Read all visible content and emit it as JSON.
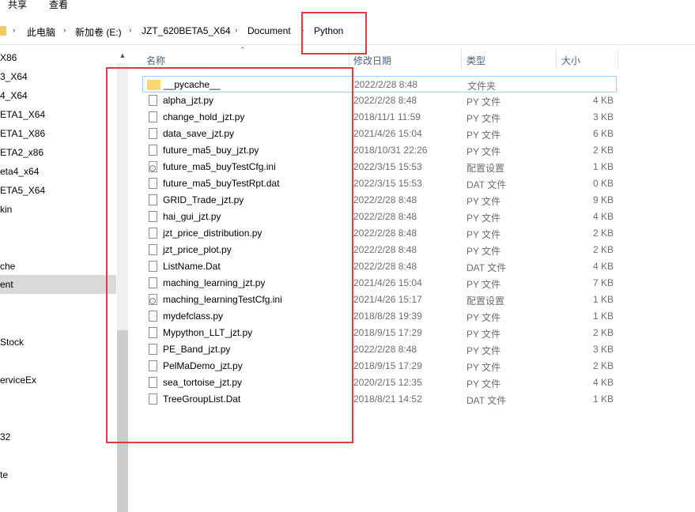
{
  "ribbon": {
    "share": "共享",
    "view": "查看"
  },
  "breadcrumb": [
    "此电脑",
    "新加卷 (E:)",
    "JZT_620BETA5_X64",
    "Document",
    "Python"
  ],
  "nav_items": [
    {
      "label": "X86",
      "selected": false
    },
    {
      "label": "3_X64",
      "selected": false
    },
    {
      "label": "4_X64",
      "selected": false
    },
    {
      "label": "ETA1_X64",
      "selected": false
    },
    {
      "label": "ETA1_X86",
      "selected": false
    },
    {
      "label": "ETA2_x86",
      "selected": false
    },
    {
      "label": "eta4_x64",
      "selected": false
    },
    {
      "label": "ETA5_X64",
      "selected": false
    },
    {
      "label": "kin",
      "selected": false
    },
    {
      "label": "che",
      "selected": false
    },
    {
      "label": "ent",
      "selected": true
    },
    {
      "label": "Stock",
      "selected": false
    },
    {
      "label": "erviceEx",
      "selected": false
    },
    {
      "label": "32",
      "selected": false
    },
    {
      "label": "te",
      "selected": false
    }
  ],
  "columns": {
    "name": "名称",
    "date": "修改日期",
    "type": "类型",
    "size": "大小"
  },
  "files": [
    {
      "name": "__pycache__",
      "date": "2022/2/28 8:48",
      "type": "文件夹",
      "size": "",
      "icon": "folder-icon",
      "selected": true
    },
    {
      "name": "alpha_jzt.py",
      "date": "2022/2/28 8:48",
      "type": "PY 文件",
      "size": "4 KB",
      "icon": "file-icon"
    },
    {
      "name": "change_hold_jzt.py",
      "date": "2018/11/1 11:59",
      "type": "PY 文件",
      "size": "3 KB",
      "icon": "file-icon"
    },
    {
      "name": "data_save_jzt.py",
      "date": "2021/4/26 15:04",
      "type": "PY 文件",
      "size": "6 KB",
      "icon": "file-icon"
    },
    {
      "name": "future_ma5_buy_jzt.py",
      "date": "2018/10/31 22:26",
      "type": "PY 文件",
      "size": "2 KB",
      "icon": "file-icon"
    },
    {
      "name": "future_ma5_buyTestCfg.ini",
      "date": "2022/3/15 15:53",
      "type": "配置设置",
      "size": "1 KB",
      "icon": "config-file-icon"
    },
    {
      "name": "future_ma5_buyTestRpt.dat",
      "date": "2022/3/15 15:53",
      "type": "DAT 文件",
      "size": "0 KB",
      "icon": "file-icon"
    },
    {
      "name": "GRID_Trade_jzt.py",
      "date": "2022/2/28 8:48",
      "type": "PY 文件",
      "size": "9 KB",
      "icon": "file-icon"
    },
    {
      "name": "hai_gui_jzt.py",
      "date": "2022/2/28 8:48",
      "type": "PY 文件",
      "size": "4 KB",
      "icon": "file-icon"
    },
    {
      "name": "jzt_price_distribution.py",
      "date": "2022/2/28 8:48",
      "type": "PY 文件",
      "size": "2 KB",
      "icon": "file-icon"
    },
    {
      "name": "jzt_price_plot.py",
      "date": "2022/2/28 8:48",
      "type": "PY 文件",
      "size": "2 KB",
      "icon": "file-icon"
    },
    {
      "name": "ListName.Dat",
      "date": "2022/2/28 8:48",
      "type": "DAT 文件",
      "size": "4 KB",
      "icon": "file-icon"
    },
    {
      "name": "maching_learning_jzt.py",
      "date": "2021/4/26 15:04",
      "type": "PY 文件",
      "size": "7 KB",
      "icon": "file-icon"
    },
    {
      "name": "maching_learningTestCfg.ini",
      "date": "2021/4/26 15:17",
      "type": "配置设置",
      "size": "1 KB",
      "icon": "config-file-icon"
    },
    {
      "name": "mydefclass.py",
      "date": "2018/8/28 19:39",
      "type": "PY 文件",
      "size": "1 KB",
      "icon": "file-icon"
    },
    {
      "name": "Mypython_LLT_jzt.py",
      "date": "2018/9/15 17:29",
      "type": "PY 文件",
      "size": "2 KB",
      "icon": "file-icon"
    },
    {
      "name": "PE_Band_jzt.py",
      "date": "2022/2/28 8:48",
      "type": "PY 文件",
      "size": "3 KB",
      "icon": "file-icon"
    },
    {
      "name": "PelMaDemo_jzt.py",
      "date": "2018/9/15 17:29",
      "type": "PY 文件",
      "size": "2 KB",
      "icon": "file-icon"
    },
    {
      "name": "sea_tortoise_jzt.py",
      "date": "2020/2/15 12:35",
      "type": "PY 文件",
      "size": "4 KB",
      "icon": "file-icon"
    },
    {
      "name": "TreeGroupList.Dat",
      "date": "2018/8/21 14:52",
      "type": "DAT 文件",
      "size": "1 KB",
      "icon": "file-icon"
    }
  ],
  "colors": {
    "annotation": "#e33b3b",
    "header_text": "#4c607a",
    "selection_border": "#99d1ff",
    "folder": "#f8d775"
  }
}
